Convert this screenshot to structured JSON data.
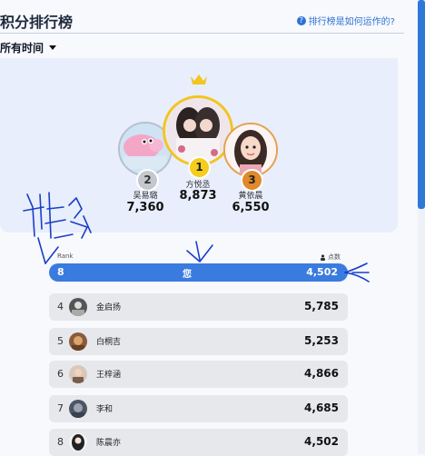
{
  "header": {
    "title": "积分排行榜",
    "help_text": "排行榜是如何运作的?",
    "help_icon": "?"
  },
  "filter": {
    "label": "所有时间"
  },
  "podium": {
    "second": {
      "rank": "2",
      "name": "吴易璐",
      "score": "7,360"
    },
    "first": {
      "rank": "1",
      "name": "方悦丞",
      "score": "8,873"
    },
    "third": {
      "rank": "3",
      "name": "黄依晨",
      "score": "6,550"
    }
  },
  "columns": {
    "rank": "Rank",
    "points": "点数"
  },
  "me": {
    "rank": "8",
    "name": "您",
    "score": "4,502"
  },
  "rows": [
    {
      "rank": "4",
      "name": "金启扬",
      "score": "5,785"
    },
    {
      "rank": "5",
      "name": "白桐吉",
      "score": "5,253"
    },
    {
      "rank": "6",
      "name": "王梓涵",
      "score": "4,866"
    },
    {
      "rank": "7",
      "name": "李和",
      "score": "4,685"
    },
    {
      "rank": "8",
      "name": "陈晨亦",
      "score": "4,502"
    }
  ],
  "colors": {
    "accent": "#3a7be0",
    "gold": "#f5cd1d",
    "silver": "#c4c8ce",
    "bronze": "#e08a2b",
    "ink": "#1a3ec9"
  }
}
